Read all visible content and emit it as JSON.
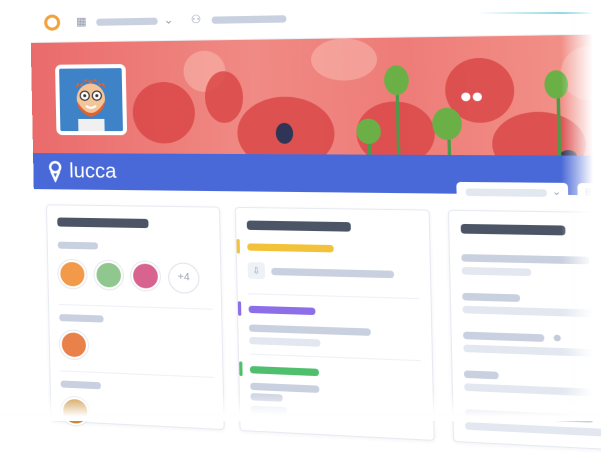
{
  "brand": {
    "name": "lucca"
  },
  "topbar": {
    "grid_icon": "grid-icon",
    "chevron_icon": "chevron-down-icon",
    "people_icon": "people-icon",
    "clock_icon": "clock-icon",
    "bell_icon": "bell-icon"
  },
  "team": {
    "more_label": "+4"
  },
  "colors": {
    "brand_blue": "#4a69d8",
    "banner_red": "#ea6b6b",
    "accent_yellow": "#f2c33a",
    "accent_purple": "#8b6ee8",
    "accent_green": "#4fbf6e",
    "logo_orange": "#f2a23a"
  }
}
